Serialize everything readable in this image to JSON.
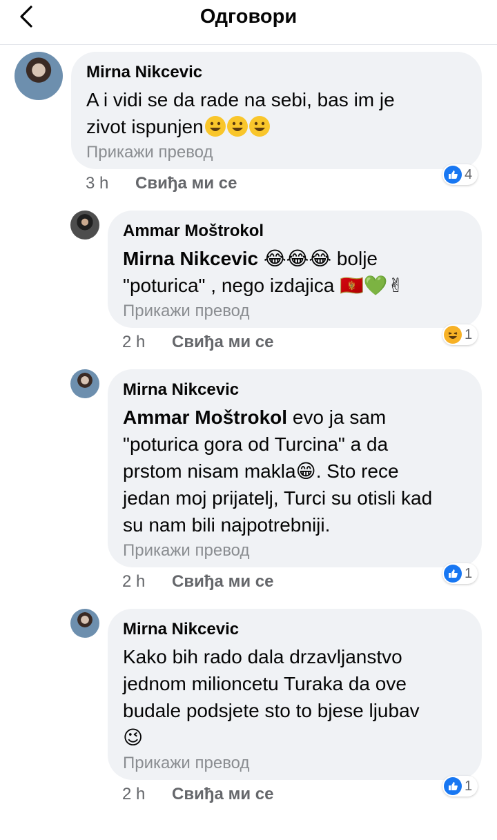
{
  "header": {
    "title": "Одговори"
  },
  "labels": {
    "translate": "Прикажи превод",
    "like": "Свиђа ми се"
  },
  "comments": [
    {
      "author": "Mirna Nikcevic",
      "text_lines": [
        "A i vidi se da rade na sebi, bas im je",
        "zivot ispunjen"
      ],
      "emoji_after": "😀😀😀",
      "time": "3 h",
      "reaction_count": "4",
      "reaction_icon": "like-icon"
    },
    {
      "author": "Ammar Moštrokol",
      "mention": "Mirna Nikcevic",
      "text_lines": [
        "bolje",
        "\"poturica\" , nego izdajica"
      ],
      "emoji_after_line1": "😂😂😂",
      "emoji_after_line2": "🇲🇪💚✌",
      "time": "2 h",
      "reaction_count": "1",
      "reaction_icon": "haha-icon"
    },
    {
      "author": "Mirna Nikcevic",
      "mention": "Ammar Moštrokol",
      "text_lines": [
        "evo ja sam",
        "\"poturica gora od Turcina\" a da",
        "prstom nisam makla",
        ". Sto rece",
        "jedan moj prijatelj, Turci su otisli kad",
        "su nam bili najpotrebniji."
      ],
      "emoji_inline": "😁",
      "time": "2 h",
      "reaction_count": "1",
      "reaction_icon": "like-icon"
    },
    {
      "author": "Mirna Nikcevic",
      "text_lines": [
        "Kako bih rado dala drzavljanstvo",
        "jednom milioncetu Turaka da ove",
        "budale podsjete sto to bjese ljubav"
      ],
      "emoji_last_line": "😉",
      "time": "2 h",
      "reaction_count": "1",
      "reaction_icon": "like-icon"
    }
  ],
  "colors": {
    "bubble": "#f0f2f5",
    "like_blue": "#1877f2",
    "meta_gray": "#65676b"
  }
}
